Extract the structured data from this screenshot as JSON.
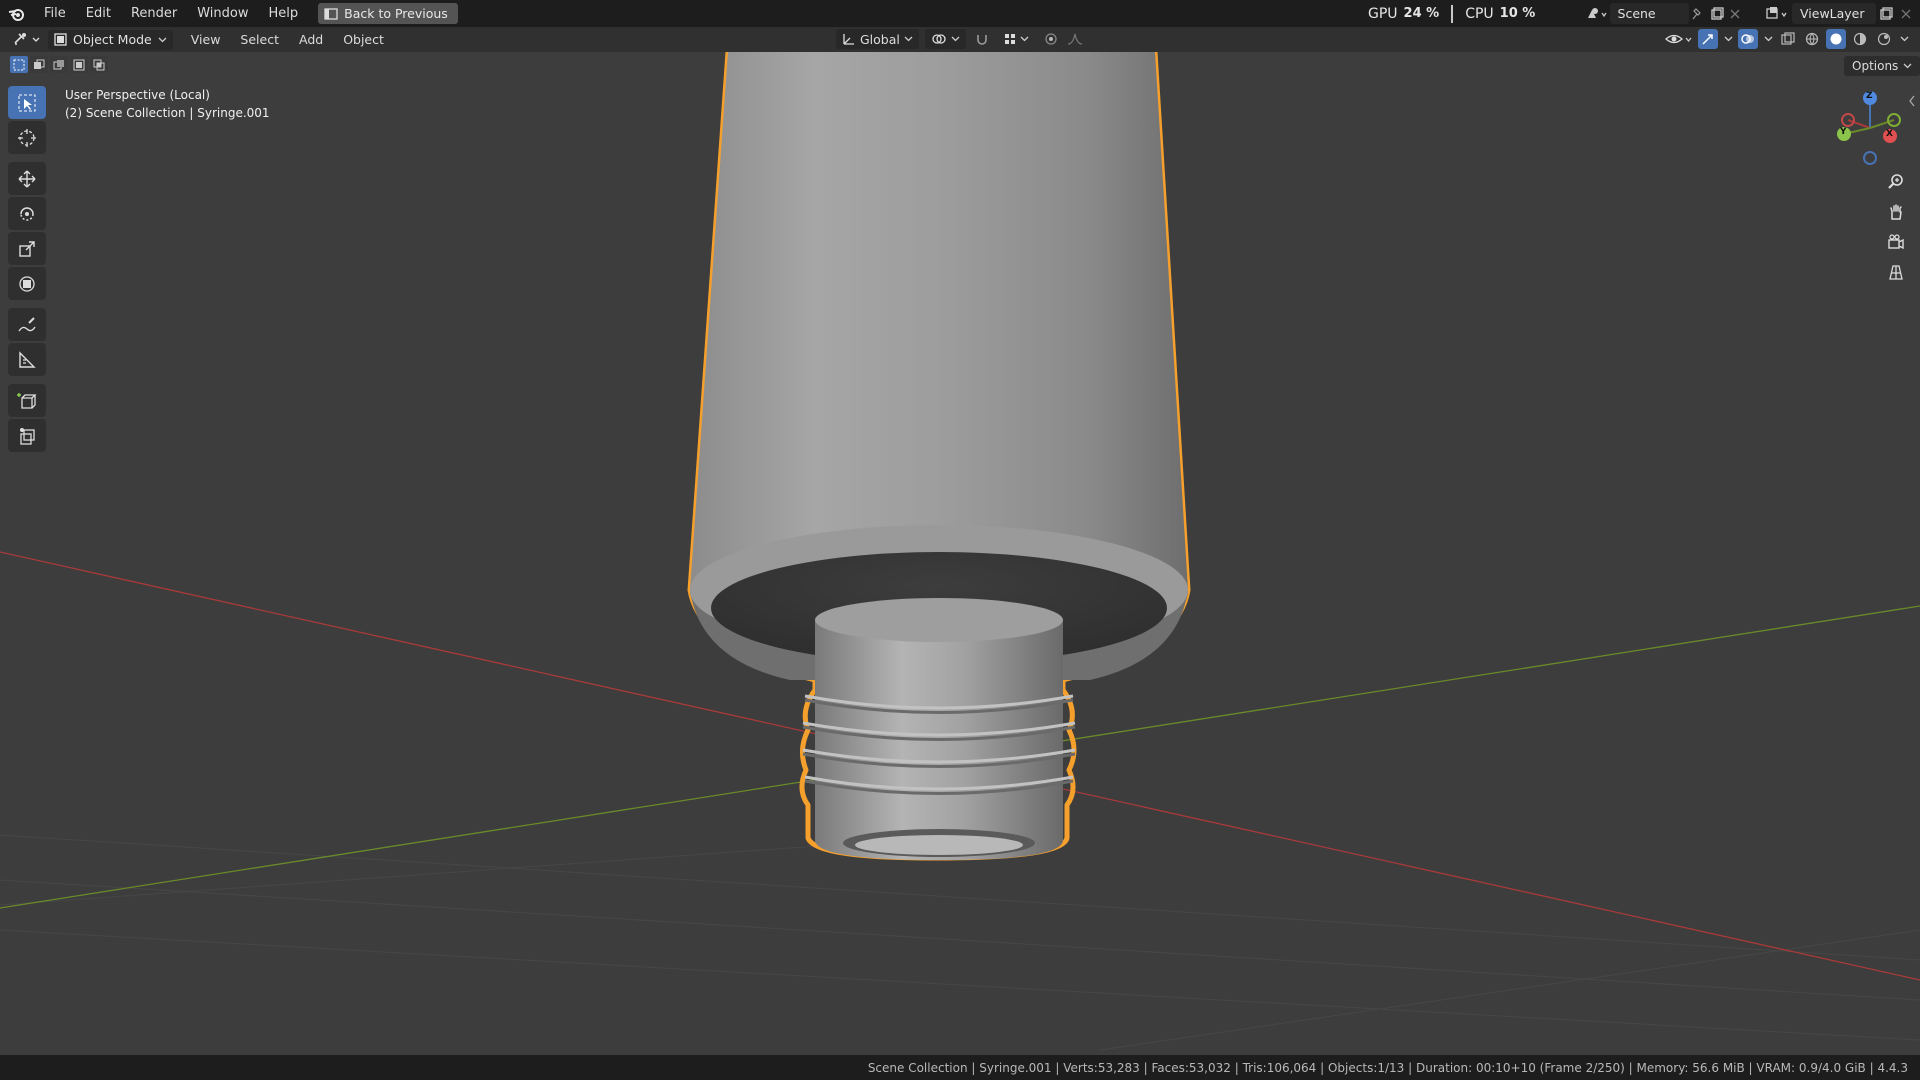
{
  "menubar": {
    "items": [
      "File",
      "Edit",
      "Render",
      "Window",
      "Help"
    ],
    "back_button": "Back to Previous"
  },
  "stats": {
    "gpu_label": "GPU",
    "gpu_value": "24 %",
    "cpu_label": "CPU",
    "cpu_value": "10 %"
  },
  "scene": {
    "name": "Scene"
  },
  "view_layer": {
    "name": "ViewLayer"
  },
  "header": {
    "mode": "Object Mode",
    "menus": [
      "View",
      "Select",
      "Add",
      "Object"
    ],
    "orientation": "Global"
  },
  "viewport": {
    "perspective": "User Perspective (Local)",
    "collection_info": "(2) Scene Collection | Syringe.001",
    "options_label": "Options",
    "gizmo": {
      "z": "Z",
      "x": "X",
      "y": "Y"
    }
  },
  "statusbar": {
    "text": "Scene Collection | Syringe.001 | Verts:53,283 | Faces:53,032 | Tris:106,064 | Objects:1/13 | Duration: 00:10+10 (Frame 2/250) | Memory: 56.6 MiB | VRAM: 0.9/4.0 GiB | 4.4.3"
  },
  "colors": {
    "accent": "#4772b3",
    "selection_outline": "#f5a02c",
    "x_axis": "#a83a3a",
    "y_axis": "#6a8a2a",
    "viewport_bg": "#3d3d3d"
  }
}
